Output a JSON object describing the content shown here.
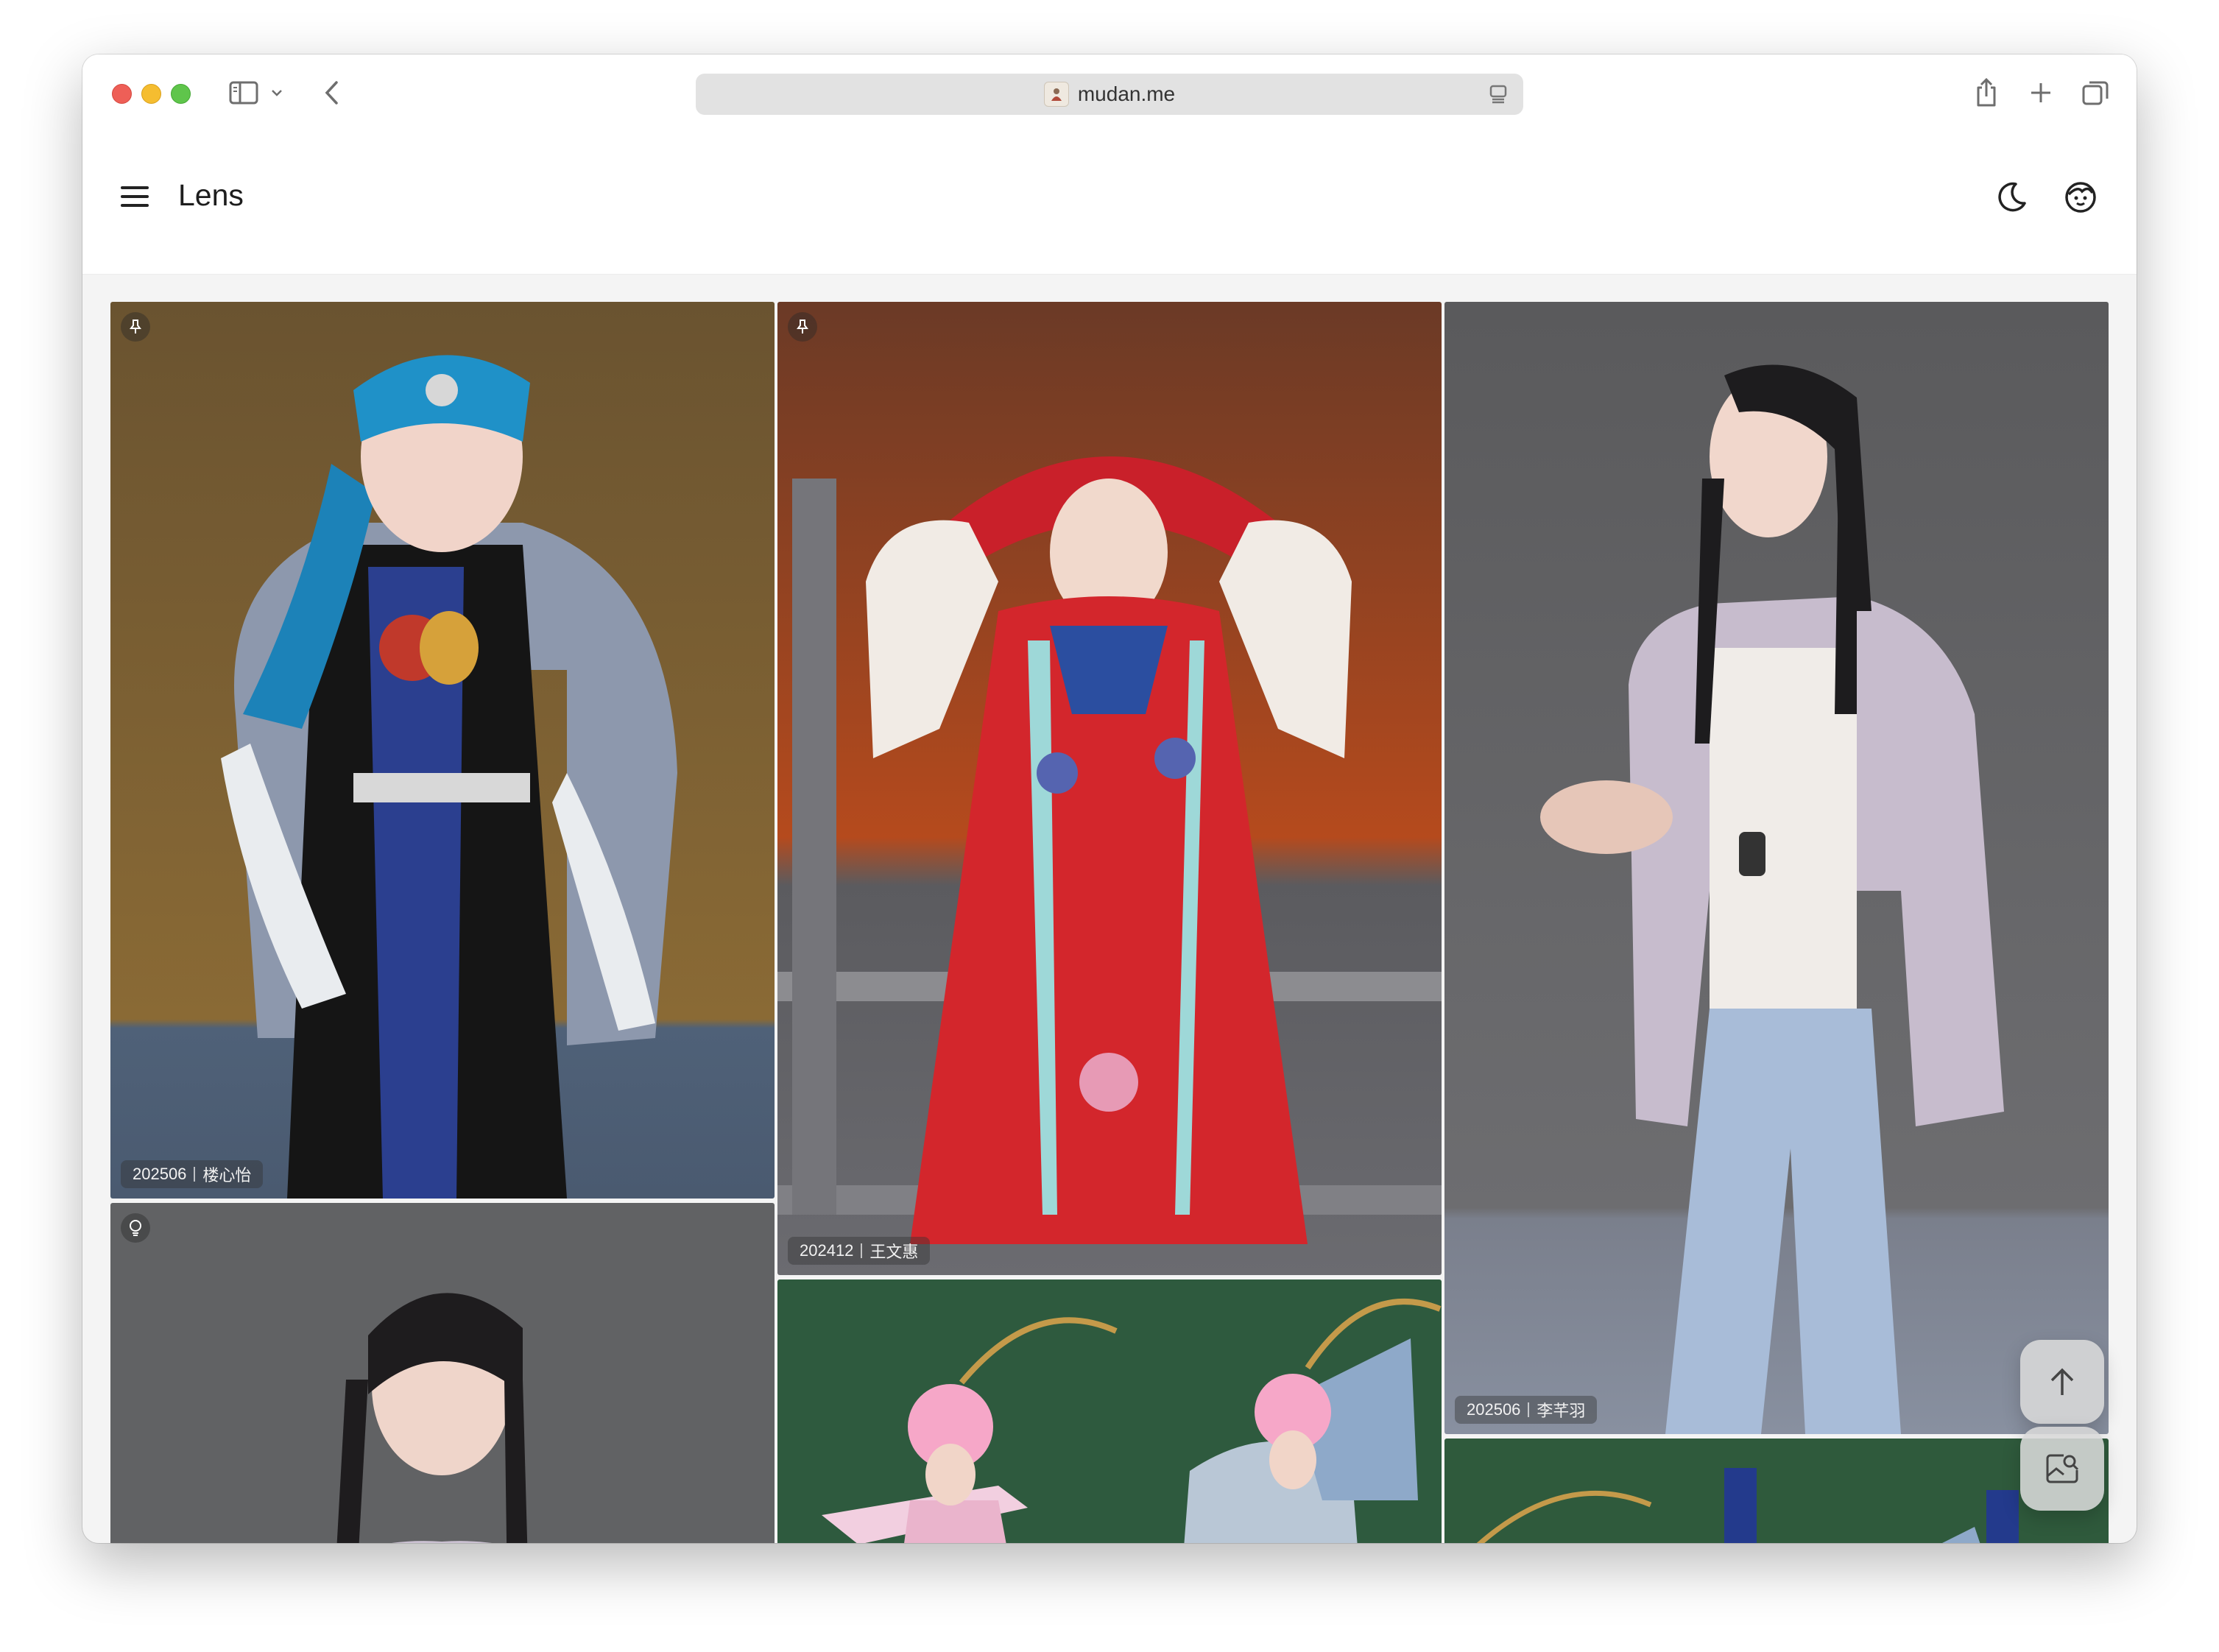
{
  "browser": {
    "url": "mudan.me"
  },
  "app": {
    "title": "Lens"
  },
  "photos": [
    {
      "date": "202506",
      "name": "楼心怡",
      "badge": "pin-icon"
    },
    {
      "date": "202412",
      "name": "王文惠",
      "badge": "pin-icon"
    },
    {
      "date": "202506",
      "name": "李芊羽",
      "badge": ""
    },
    {
      "date": "",
      "name": "",
      "badge": "lightbulb-icon"
    },
    {
      "date": "",
      "name": "",
      "badge": ""
    },
    {
      "date": "",
      "name": "",
      "badge": ""
    }
  ],
  "fabs": [
    "arrow-up-icon",
    "image-search-icon"
  ]
}
